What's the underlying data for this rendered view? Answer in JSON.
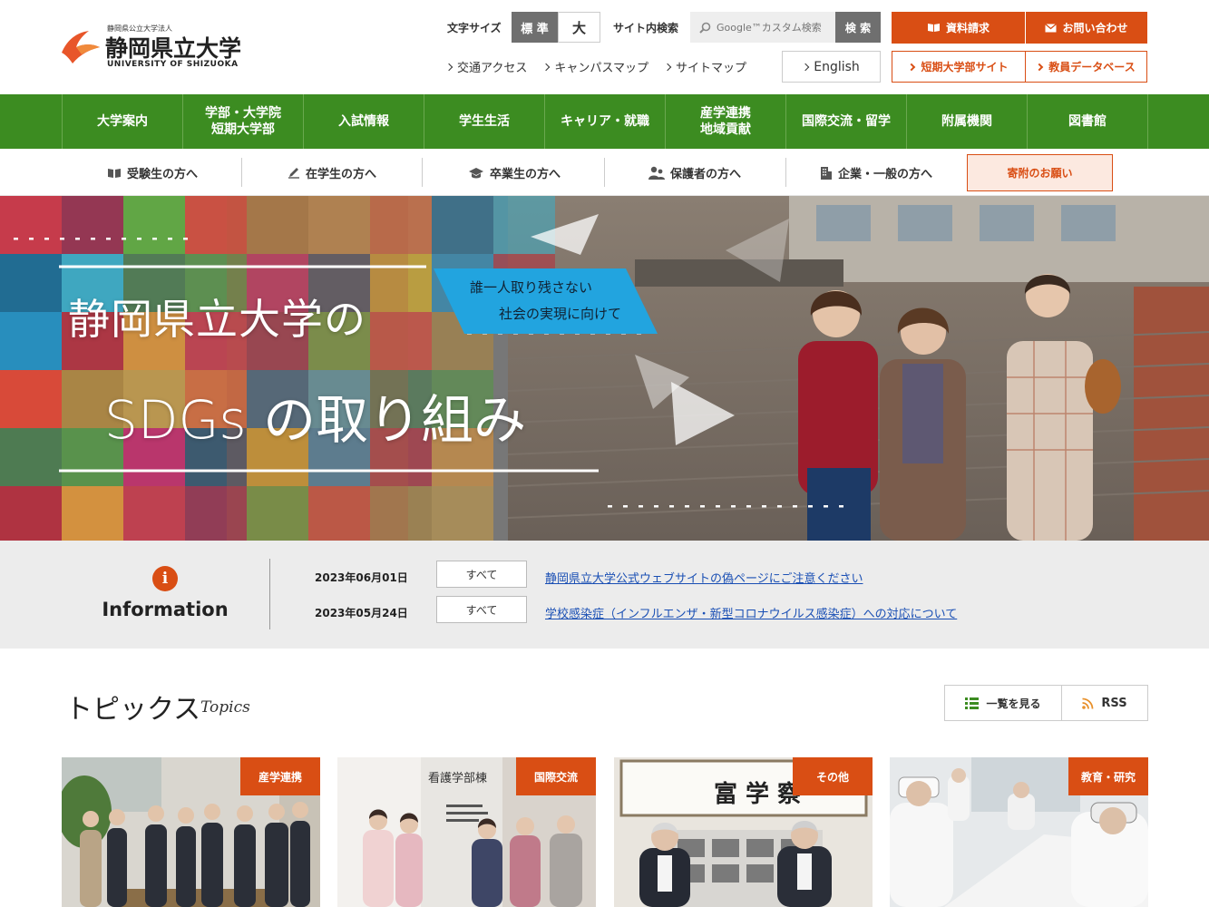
{
  "header": {
    "logo_small": "静岡県公立大学法人",
    "logo_main": "静岡県立大学",
    "logo_en": "UNIVERSITY OF SHIZUOKA",
    "font_size_label": "文字サイズ",
    "font_std": "標 準",
    "font_large": "大",
    "search_label": "サイト内検索",
    "search_placeholder": "Google™カスタム検索",
    "search_button": "検 索",
    "links": [
      "交通アクセス",
      "キャンパスマップ",
      "サイトマップ"
    ],
    "english": "English",
    "request_docs": "資料請求",
    "contact": "お問い合わせ",
    "junior_college_site": "短期大学部サイト",
    "faculty_db": "教員データベース"
  },
  "main_nav": [
    "大学案内",
    "学部・大学院\n短期大学部",
    "入試情報",
    "学生生活",
    "キャリア・就職",
    "産学連携\n地域貢献",
    "国際交流・留学",
    "附属機関",
    "図書館"
  ],
  "audience_nav": [
    {
      "label": "受験生の方へ",
      "icon": "book-icon"
    },
    {
      "label": "在学生の方へ",
      "icon": "pencil-icon"
    },
    {
      "label": "卒業生の方へ",
      "icon": "graduation-cap-icon"
    },
    {
      "label": "保護者の方へ",
      "icon": "parents-icon"
    },
    {
      "label": "企業・一般の方へ",
      "icon": "building-icon"
    }
  ],
  "donate": "寄附のお願い",
  "hero": {
    "title_line1": "静岡県立大学の",
    "title_line2": "SDGs の取り組み",
    "tag_line1": "誰一人取り残さない",
    "tag_line2": "社会の実現に向けて"
  },
  "information": {
    "title": "Information",
    "icon": "i",
    "news": [
      {
        "date": "2023年06月01日",
        "category": "すべて",
        "text": "静岡県立大学公式ウェブサイトの偽ページにご注意ください"
      },
      {
        "date": "2023年05月24日",
        "category": "すべて",
        "text": "学校感染症（インフルエンザ・新型コロナウイルス感染症）への対応について"
      }
    ]
  },
  "topics": {
    "title": "トピックス",
    "subtitle": "Topics",
    "list_button": "一覧を見る",
    "rss_button": "RSS",
    "cards": [
      {
        "tag": "産学連携"
      },
      {
        "tag": "国際交流",
        "sign_text": "看護学部棟"
      },
      {
        "tag": "その他",
        "calligraphy": "富 学 察"
      },
      {
        "tag": "教育・研究"
      }
    ]
  },
  "colors": {
    "accent_orange": "#d94e14",
    "nav_green": "#3c8c21",
    "link_blue": "#1a4fb4"
  }
}
